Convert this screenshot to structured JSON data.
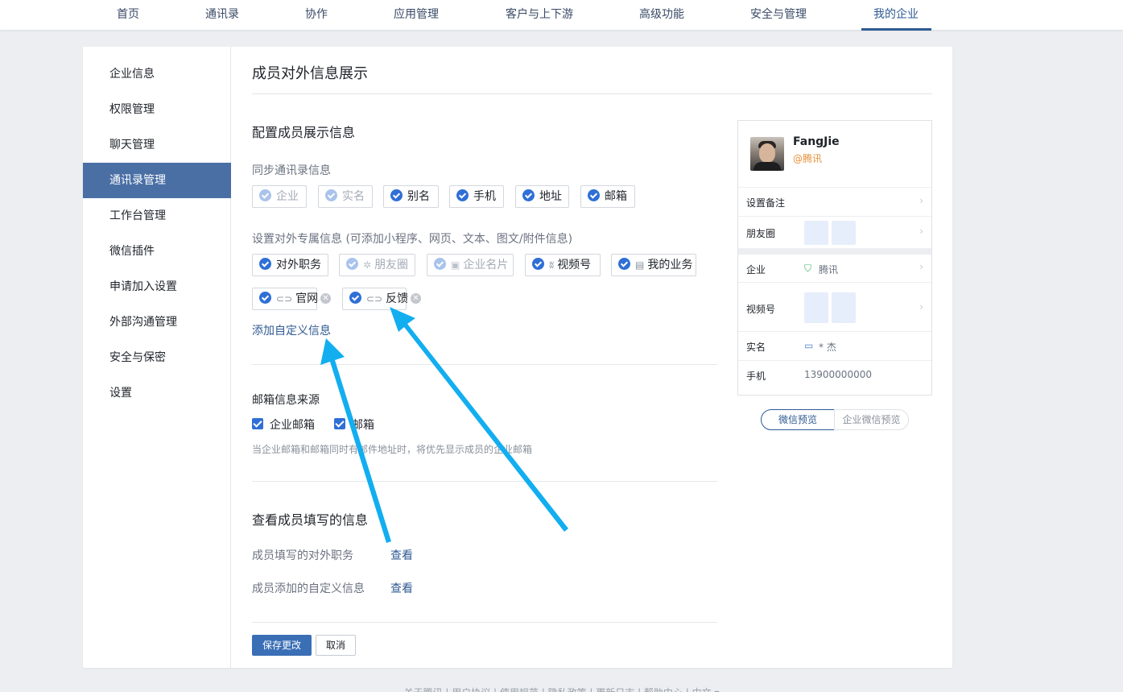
{
  "topnav": {
    "items": [
      "首页",
      "通讯录",
      "协作",
      "应用管理",
      "客户与上下游",
      "高级功能",
      "安全与管理",
      "我的企业"
    ]
  },
  "sidebar": {
    "items": [
      "企业信息",
      "权限管理",
      "聊天管理",
      "通讯录管理",
      "工作台管理",
      "微信插件",
      "申请加入设置",
      "外部沟通管理",
      "安全与保密",
      "设置"
    ]
  },
  "main": {
    "title": "成员对外信息展示",
    "config_title": "配置成员展示信息",
    "sync_label": "同步通讯录信息",
    "sync_tags": [
      "企业",
      "实名",
      "别名",
      "手机",
      "地址",
      "邮箱"
    ],
    "exclusive_label": "设置对外专属信息 (可添加小程序、网页、文本、图文/附件信息)",
    "exclusive_tags": [
      "对外职务",
      "朋友圈",
      "企业名片",
      "视频号",
      "我的业务"
    ],
    "custom_tags": [
      "官网",
      "反馈"
    ],
    "add_custom": "添加自定义信息",
    "email_source_title": "邮箱信息来源",
    "email_options": [
      "企业邮箱",
      "邮箱"
    ],
    "email_note": "当企业邮箱和邮箱同时有邮件地址时，将优先显示成员的企业邮箱",
    "view_title": "查看成员填写的信息",
    "view_rows": [
      {
        "label": "成员填写的对外职务",
        "action": "查看"
      },
      {
        "label": "成员添加的自定义信息",
        "action": "查看"
      }
    ],
    "save_button": "保存更改",
    "cancel_button": "取消"
  },
  "preview": {
    "name": "FangJie",
    "corp": "@腾讯",
    "remark": "设置备注",
    "moments": "朋友圈",
    "company_key": "企业",
    "company_val": "腾讯",
    "channels": "视频号",
    "realname_key": "实名",
    "realname_val": "* 杰",
    "phone_key": "手机",
    "phone_val": "13900000000",
    "tab_wechat": "微信预览",
    "tab_wecom": "企业微信预览"
  },
  "footer": {
    "text": "关于腾讯 | 用户协议 | 使用规范 | 隐私政策 | 更新日志 | 帮助中心 | 中文 ▾"
  },
  "colors": {
    "accent": "#2f5a93",
    "sidebar_active": "#4a6fa5",
    "check_blue": "#2f6fd6",
    "annotation_arrow": "#12aef0"
  }
}
